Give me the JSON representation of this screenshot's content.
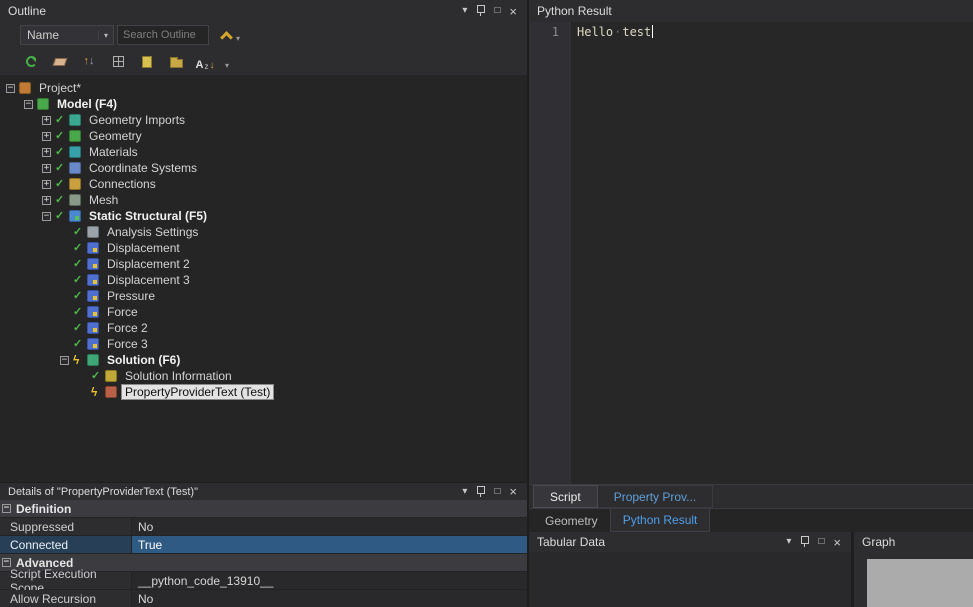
{
  "icons": {
    "chevron_down": "▾",
    "maximize": "□",
    "close": "×",
    "check": "✓",
    "bolt": "ϟ",
    "plus": "+",
    "minus": "−",
    "arrow_up": "↑",
    "arrow_down": "↓",
    "letter_a": "A",
    "letter_z": "z"
  },
  "colors": {
    "accent_blue": "#4f9fe8",
    "highlight_row": "#2e5a84",
    "check_green": "#4dbb4d",
    "bolt_yellow": "#e8c230",
    "selection_bg": "#e2e2e2",
    "graph_plot_gray": "#ababab"
  },
  "outline": {
    "title": "Outline",
    "filter": {
      "name_label": "Name",
      "search_placeholder": "Search Outline"
    },
    "tree": [
      {
        "label": "Project*",
        "level": 0,
        "expander": "minus",
        "state": null,
        "icon": "project",
        "bold": false,
        "selected": false
      },
      {
        "label": "Model (F4)",
        "level": 1,
        "expander": "minus",
        "state": null,
        "icon": "model",
        "bold": true,
        "selected": false
      },
      {
        "label": "Geometry Imports",
        "level": 2,
        "expander": "plus",
        "state": "check",
        "icon": "geometry-imports",
        "bold": false,
        "selected": false
      },
      {
        "label": "Geometry",
        "level": 2,
        "expander": "plus",
        "state": "check",
        "icon": "geometry",
        "bold": false,
        "selected": false
      },
      {
        "label": "Materials",
        "level": 2,
        "expander": "plus",
        "state": "check",
        "icon": "materials",
        "bold": false,
        "selected": false
      },
      {
        "label": "Coordinate Systems",
        "level": 2,
        "expander": "plus",
        "state": "check",
        "icon": "coordinate-systems",
        "bold": false,
        "selected": false
      },
      {
        "label": "Connections",
        "level": 2,
        "expander": "plus",
        "state": "check",
        "icon": "connections",
        "bold": false,
        "selected": false
      },
      {
        "label": "Mesh",
        "level": 2,
        "expander": "plus",
        "state": "check",
        "icon": "mesh",
        "bold": false,
        "selected": false
      },
      {
        "label": "Static Structural (F5)",
        "level": 2,
        "expander": "minus",
        "state": "check",
        "icon": "static-structural",
        "bold": true,
        "selected": false
      },
      {
        "label": "Analysis Settings",
        "level": 3,
        "expander": null,
        "state": "check",
        "icon": "analysis-settings",
        "bold": false,
        "selected": false
      },
      {
        "label": "Displacement",
        "level": 3,
        "expander": null,
        "state": "check",
        "icon": "displacement",
        "bold": false,
        "selected": false
      },
      {
        "label": "Displacement 2",
        "level": 3,
        "expander": null,
        "state": "check",
        "icon": "displacement",
        "bold": false,
        "selected": false
      },
      {
        "label": "Displacement 3",
        "level": 3,
        "expander": null,
        "state": "check",
        "icon": "displacement",
        "bold": false,
        "selected": false
      },
      {
        "label": "Pressure",
        "level": 3,
        "expander": null,
        "state": "check",
        "icon": "pressure",
        "bold": false,
        "selected": false
      },
      {
        "label": "Force",
        "level": 3,
        "expander": null,
        "state": "check",
        "icon": "force",
        "bold": false,
        "selected": false
      },
      {
        "label": "Force 2",
        "level": 3,
        "expander": null,
        "state": "check",
        "icon": "force",
        "bold": false,
        "selected": false
      },
      {
        "label": "Force 3",
        "level": 3,
        "expander": null,
        "state": "check",
        "icon": "force",
        "bold": false,
        "selected": false
      },
      {
        "label": "Solution (F6)",
        "level": 3,
        "expander": "minus",
        "state": "bolt",
        "icon": "solution",
        "bold": true,
        "selected": false
      },
      {
        "label": "Solution Information",
        "level": 4,
        "expander": null,
        "state": "check",
        "icon": "solution-information",
        "bold": false,
        "selected": false
      },
      {
        "label": "PropertyProviderText (Test)",
        "level": 4,
        "expander": null,
        "state": "bolt",
        "icon": "property-provider",
        "bold": false,
        "selected": true
      }
    ]
  },
  "details": {
    "title": "Details of \"PropertyProviderText (Test)\"",
    "rows": [
      {
        "type": "category",
        "label": "Definition"
      },
      {
        "type": "prop",
        "name": "Suppressed",
        "value": "No",
        "highlight": false
      },
      {
        "type": "prop",
        "name": "Connected",
        "value": "True",
        "highlight": true
      },
      {
        "type": "category",
        "label": "Advanced"
      },
      {
        "type": "prop",
        "name": "Script Execution Scope",
        "value": "__python_code_13910__",
        "highlight": false
      },
      {
        "type": "prop",
        "name": "Allow Recursion",
        "value": "No",
        "highlight": false
      }
    ]
  },
  "editor": {
    "title": "Python Result",
    "line_number": "1",
    "code_words": [
      "Hello",
      "test"
    ],
    "whitespace_dot": "·"
  },
  "tabs_row1": [
    {
      "label": "Script",
      "active": true
    },
    {
      "label": "Property Prov...",
      "active": false
    }
  ],
  "tabs_row2": [
    {
      "label": "Geometry",
      "active": false
    },
    {
      "label": "Python Result",
      "active": true
    }
  ],
  "tabular": {
    "title": "Tabular Data"
  },
  "graph": {
    "title": "Graph"
  }
}
